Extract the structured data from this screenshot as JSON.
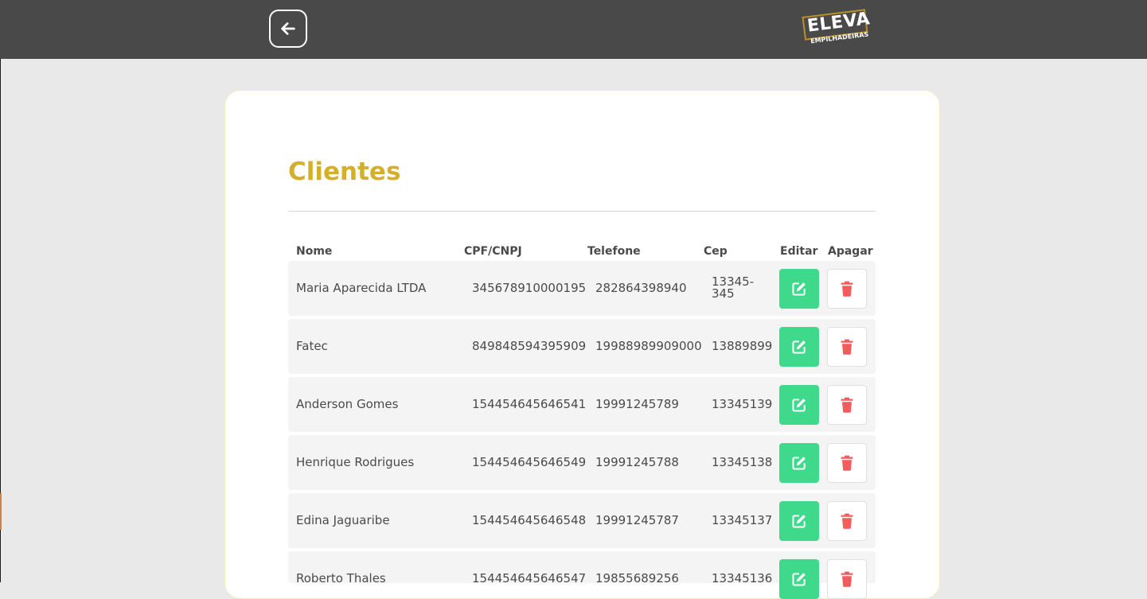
{
  "header": {
    "back_icon": "arrow-left-icon",
    "logo": {
      "main": "ELEVA",
      "sub": "EMPILHADEIRAS"
    }
  },
  "page": {
    "title": "Clientes"
  },
  "table": {
    "columns": [
      "Nome",
      "CPF/CNPJ",
      "Telefone",
      "Cep",
      "Editar",
      "Apagar"
    ],
    "rows": [
      {
        "nome": "Maria Aparecida LTDA",
        "cpf_cnpj": "345678910000195",
        "telefone": "282864398940",
        "cep": "13345-345"
      },
      {
        "nome": "Fatec",
        "cpf_cnpj": "849848594395909",
        "telefone": "19988989909000",
        "cep": "13889899"
      },
      {
        "nome": "Anderson Gomes",
        "cpf_cnpj": "154454645646541",
        "telefone": "19991245789",
        "cep": "13345139"
      },
      {
        "nome": "Henrique Rodrigues",
        "cpf_cnpj": "154454645646549",
        "telefone": "19991245788",
        "cep": "13345138"
      },
      {
        "nome": "Edina Jaguaribe",
        "cpf_cnpj": "154454645646548",
        "telefone": "19991245787",
        "cep": "13345137"
      },
      {
        "nome": "Roberto Thales",
        "cpf_cnpj": "154454645646547",
        "telefone": "19855689256",
        "cep": "13345136"
      }
    ],
    "edit_icon": "edit-icon",
    "delete_icon": "trash-icon"
  },
  "colors": {
    "topbar": "#494949",
    "title": "#d4af2b",
    "edit_button": "#3ed98a",
    "delete_icon": "#f25c5c",
    "row_bg": "#f4f4f4"
  }
}
